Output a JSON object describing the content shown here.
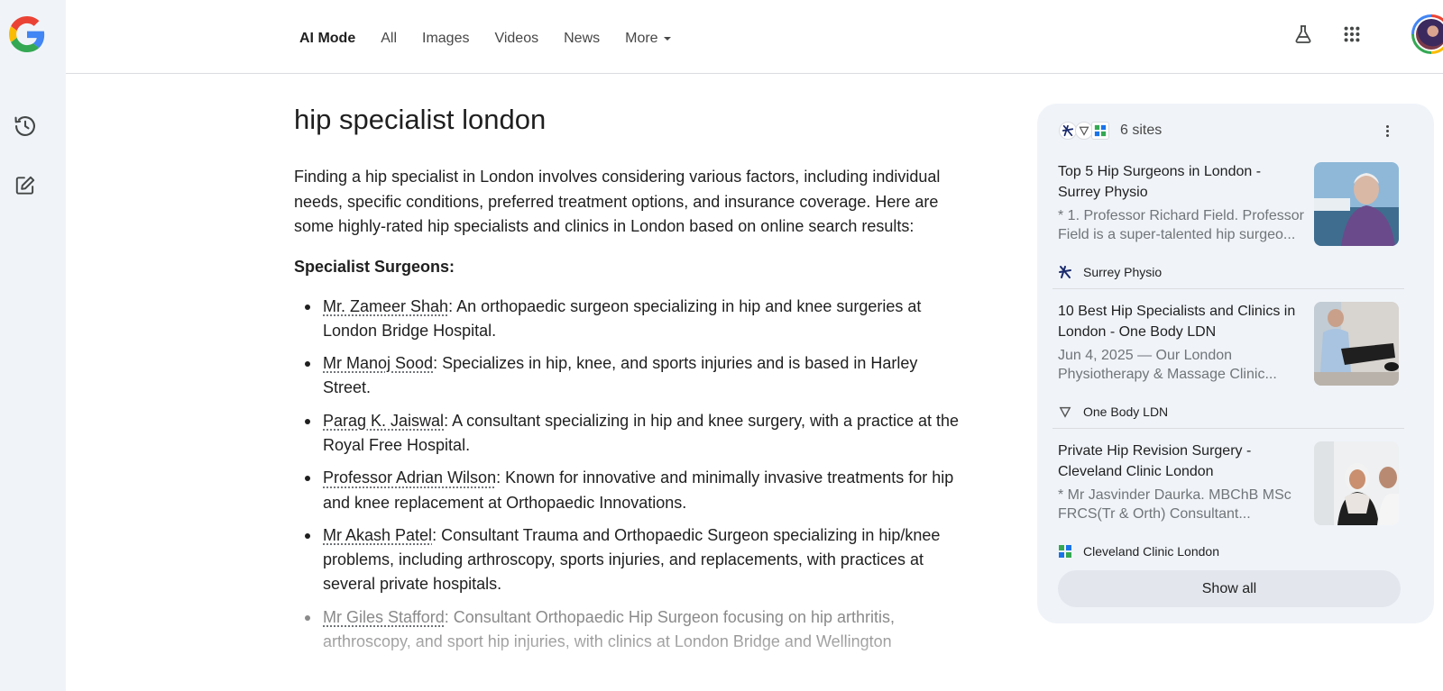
{
  "nav": {
    "tabs": [
      {
        "label": "AI Mode",
        "active": true
      },
      {
        "label": "All"
      },
      {
        "label": "Images"
      },
      {
        "label": "Videos"
      },
      {
        "label": "News"
      },
      {
        "label": "More"
      }
    ]
  },
  "rail": {
    "icons": [
      "google-logo",
      "history-icon",
      "new-thread-icon"
    ]
  },
  "query": "hip specialist london",
  "answer": {
    "intro": "Finding a hip specialist in London involves considering various factors, including individual needs, specific conditions, preferred treatment options, and insurance coverage. Here are some highly-rated hip specialists and clinics in London based on online search results:",
    "section_title": "Specialist Surgeons:",
    "items": [
      {
        "name": "Mr. Zameer Shah",
        "text": ": An orthopaedic surgeon specializing in hip and knee surgeries at London Bridge Hospital."
      },
      {
        "name": "Mr Manoj Sood",
        "text": ": Specializes in hip, knee, and sports injuries and is based in Harley Street."
      },
      {
        "name": "Parag K. Jaiswal",
        "text": ": A consultant specializing in hip and knee surgery, with a practice at the Royal Free Hospital."
      },
      {
        "name": "Professor Adrian Wilson",
        "text": ": Known for innovative and minimally invasive treatments for hip and knee replacement at Orthopaedic Innovations."
      },
      {
        "name": "Mr Akash Patel",
        "text": ": Consultant Trauma and Orthopaedic Surgeon specializing in hip/knee problems, including arthroscopy, sports injuries, and replacements, with practices at several private hospitals."
      },
      {
        "name": "Mr Giles Stafford",
        "text": ": Consultant Orthopaedic Hip Surgeon focusing on hip arthritis, arthroscopy, and sport hip injuries, with clinics at London Bridge and Wellington"
      }
    ]
  },
  "sources": {
    "count_label": "6 sites",
    "cards": [
      {
        "title": "Top 5 Hip Surgeons in London - Surrey Physio",
        "snippet": "* 1. Professor Richard Field. Professor Field is a super-talented hip surgeo...",
        "site": "Surrey Physio"
      },
      {
        "title": "10 Best Hip Specialists and Clinics in London - One Body LDN",
        "snippet": "Jun 4, 2025 — Our London Physiotherapy & Massage Clinic...",
        "site": "One Body LDN"
      },
      {
        "title": "Private Hip Revision Surgery - Cleveland Clinic London",
        "snippet": "* Mr Jasvinder Daurka. MBChB MSc FRCS(Tr & Orth) Consultant...",
        "site": "Cleveland Clinic London"
      }
    ],
    "show_all_label": "Show all"
  },
  "colors": {
    "rail_bg": "#f0f4f9",
    "panel_bg": "#f0f4f9",
    "text": "#1f1f1f",
    "muted": "#70757a"
  }
}
